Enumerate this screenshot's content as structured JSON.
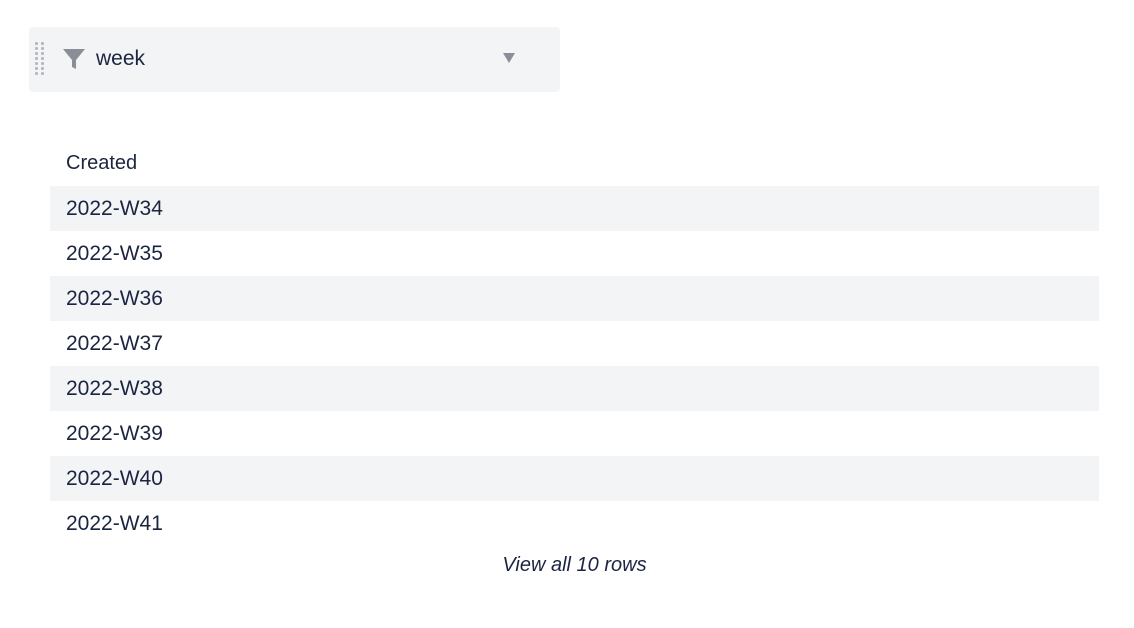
{
  "filter": {
    "label": "week",
    "icon": "filter-icon",
    "dropdown_icon": "chevron-down-icon",
    "handle_icon": "drag-handle-icon"
  },
  "table": {
    "header": "Created",
    "rows": [
      "2022-W34",
      "2022-W35",
      "2022-W36",
      "2022-W37",
      "2022-W38",
      "2022-W39",
      "2022-W40",
      "2022-W41"
    ]
  },
  "footer": {
    "view_all_label": "View all 10 rows"
  },
  "colors": {
    "text": "#1b2540",
    "row_shade": "#f3f4f6",
    "icon_gray": "#8a8e96"
  }
}
